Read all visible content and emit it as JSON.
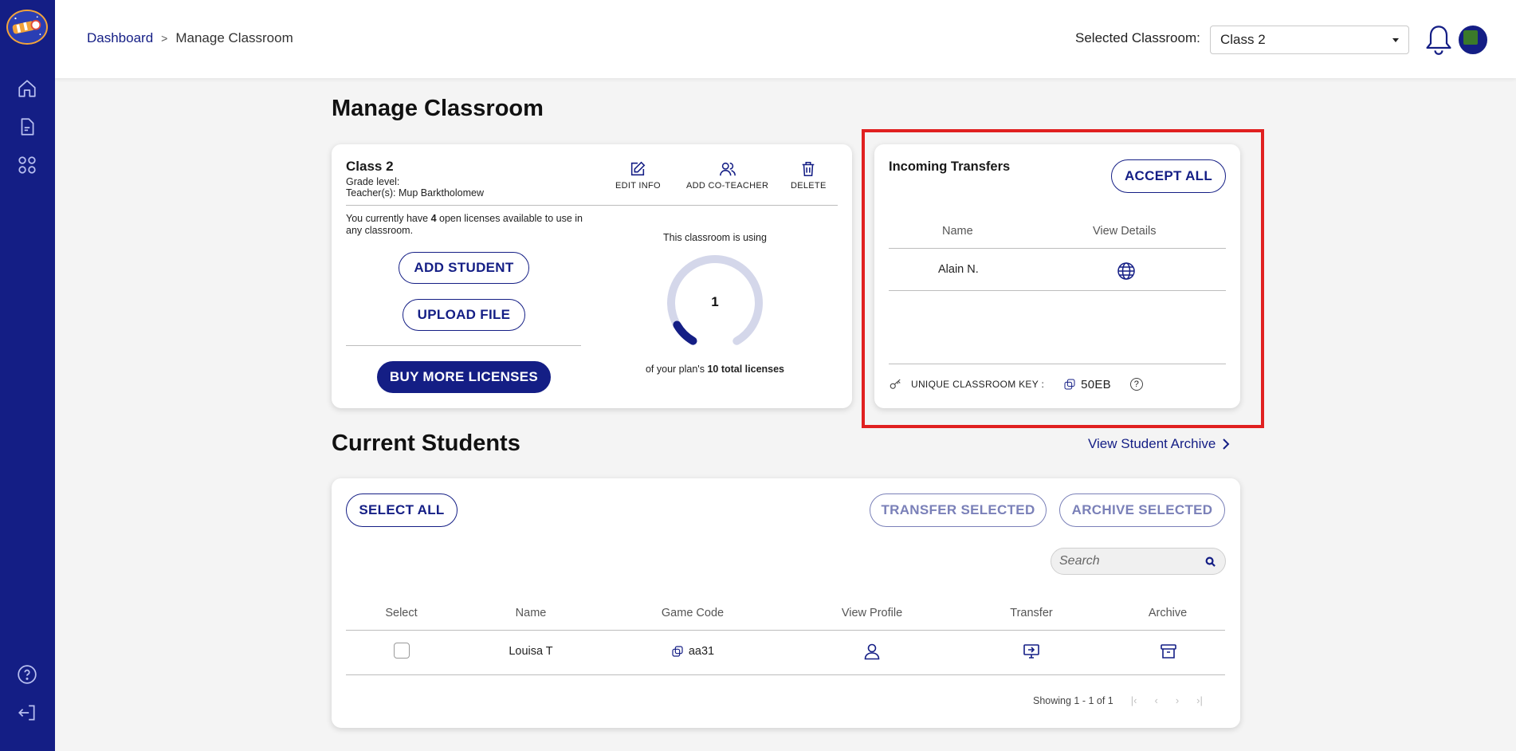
{
  "sidebar": {
    "logo": "telescope-logo",
    "items": [
      {
        "name": "home",
        "icon": "home-icon"
      },
      {
        "name": "document",
        "icon": "document-icon"
      },
      {
        "name": "apps",
        "icon": "grid-icon"
      }
    ],
    "bottom": [
      {
        "name": "help",
        "icon": "help-icon"
      },
      {
        "name": "logout",
        "icon": "logout-icon"
      }
    ]
  },
  "header": {
    "breadcrumb": {
      "root": "Dashboard",
      "separator": ">",
      "current": "Manage Classroom"
    },
    "selected_label": "Selected Classroom:",
    "selected_value": "Class 2"
  },
  "page": {
    "title": "Manage Classroom"
  },
  "class_card": {
    "name": "Class 2",
    "grade_label": "Grade level:",
    "teacher_label": "Teacher(s):",
    "teacher_value": "Mup Barktholomew",
    "actions": {
      "edit": "EDIT INFO",
      "co_teacher": "ADD CO-TEACHER",
      "delete": "DELETE"
    },
    "licenses_prefix": "You currently have",
    "licenses_count": "4",
    "licenses_suffix": "open licenses available to use in any classroom.",
    "add_student": "ADD STUDENT",
    "upload_file": "UPLOAD FILE",
    "buy_more": "BUY MORE LICENSES",
    "using_label": "This classroom is using",
    "using_count": "1",
    "plan_prefix": "of your plan's",
    "plan_total": "10 total licenses",
    "usage_fraction": 0.1
  },
  "transfers": {
    "title": "Incoming Transfers",
    "accept_all": "ACCEPT ALL",
    "columns": [
      "Name",
      "View Details"
    ],
    "rows": [
      {
        "name": "Alain N.",
        "details_icon": "globe-icon"
      }
    ],
    "key_label": "UNIQUE CLASSROOM KEY :",
    "key_value": "50EB"
  },
  "students": {
    "title": "Current Students",
    "archive_link": "View Student Archive",
    "select_all": "SELECT ALL",
    "transfer_selected": "TRANSFER SELECTED",
    "archive_selected": "ARCHIVE SELECTED",
    "search_placeholder": "Search",
    "columns": [
      "Select",
      "Name",
      "Game Code",
      "View Profile",
      "Transfer",
      "Archive"
    ],
    "rows": [
      {
        "name": "Louisa T",
        "game_code": "aa31",
        "selected": false
      }
    ],
    "paging": "Showing 1 - 1 of 1"
  },
  "colors": {
    "brand": "#141e85",
    "highlight": "#e02020",
    "background": "#f4f4f4"
  }
}
